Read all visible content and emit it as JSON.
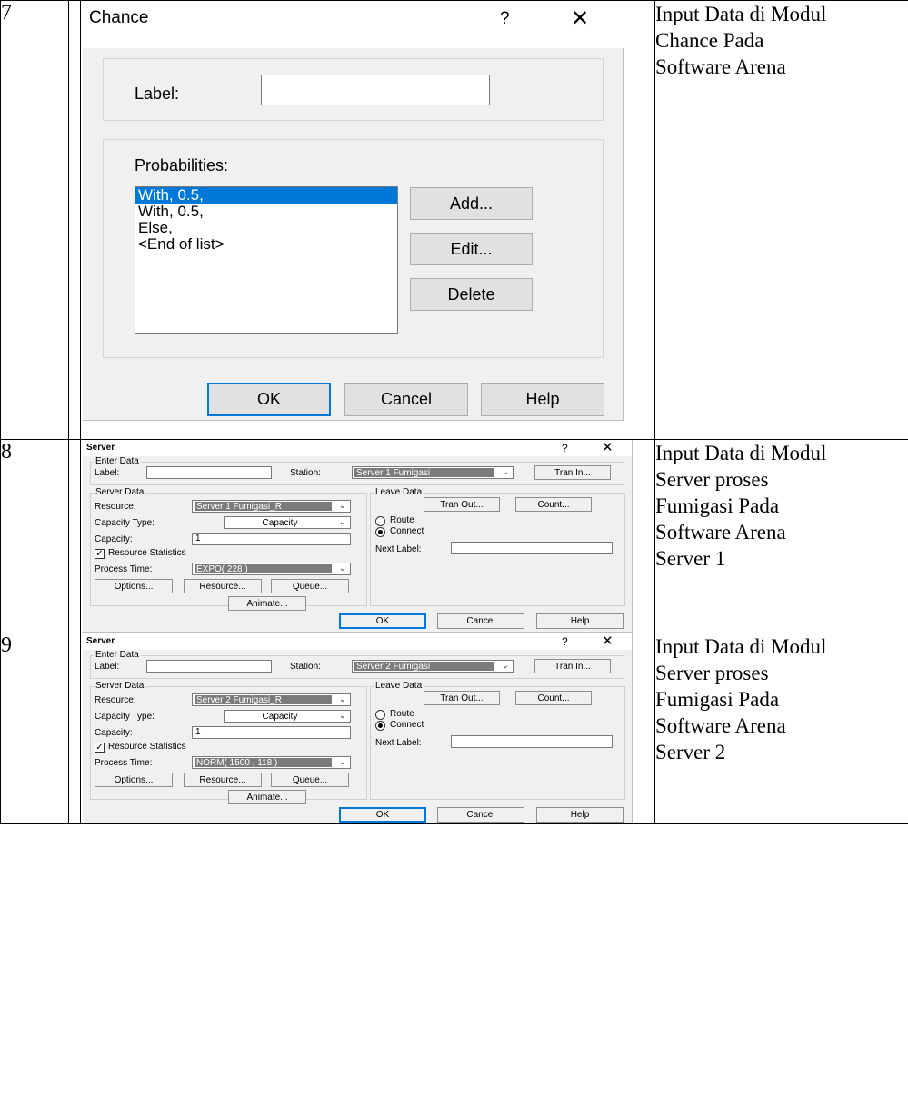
{
  "rows": [
    {
      "number": "7",
      "description": [
        "Input Data di Modul",
        "Chance Pada",
        "Software Arena"
      ]
    },
    {
      "number": "8",
      "description": [
        "Input Data di Modul",
        "Server proses",
        "Fumigasi Pada",
        "Software Arena",
        "Server 1"
      ]
    },
    {
      "number": "9",
      "description": [
        "Input Data di Modul",
        "Server proses",
        "Fumigasi Pada",
        "Software Arena",
        "Server 2"
      ]
    }
  ],
  "chance_dialog": {
    "title": "Chance",
    "help_glyph": "?",
    "close_glyph": "✕",
    "label_caption": "Label:",
    "label_value": "",
    "probabilities_caption": "Probabilities:",
    "probabilities": [
      "With, 0.5,",
      "With, 0.5,",
      "Else,",
      "<End of list>"
    ],
    "selected_index": 0,
    "add_label": "Add...",
    "edit_label": "Edit...",
    "delete_label": "Delete",
    "ok_label": "OK",
    "cancel_label": "Cancel",
    "help_label": "Help"
  },
  "server_dialogs": [
    {
      "title": "Server",
      "help_glyph": "?",
      "close_glyph": "✕",
      "enter_data_title": "Enter Data",
      "label_caption": "Label:",
      "label_value": "",
      "station_caption": "Station:",
      "station_value": "Server 1 Fumigasi",
      "tran_in_label": "Tran In...",
      "server_data_title": "Server Data",
      "resource_caption": "Resource:",
      "resource_value": "Server 1 Fumigasi_R",
      "capacity_type_caption": "Capacity Type:",
      "capacity_type_value": "Capacity",
      "capacity_caption": "Capacity:",
      "capacity_value": "1",
      "resource_statistics_label": "Resource Statistics",
      "resource_statistics_checked": true,
      "process_time_caption": "Process Time:",
      "process_time_value": "EXPO( 228 )",
      "options_label": "Options...",
      "resource_button_label": "Resource...",
      "queue_label": "Queue...",
      "animate_label": "Animate...",
      "leave_data_title": "Leave Data",
      "tran_out_label": "Tran Out...",
      "count_label": "Count...",
      "route_label": "Route",
      "connect_label": "Connect",
      "selected_leave_option": "Connect",
      "next_label_caption": "Next Label:",
      "next_label_value": "",
      "ok_label": "OK",
      "cancel_label": "Cancel",
      "help_label": "Help"
    },
    {
      "title": "Server",
      "help_glyph": "?",
      "close_glyph": "✕",
      "enter_data_title": "Enter Data",
      "label_caption": "Label:",
      "label_value": "",
      "station_caption": "Station:",
      "station_value": "Server 2 Fumigasi",
      "tran_in_label": "Tran In...",
      "server_data_title": "Server Data",
      "resource_caption": "Resource:",
      "resource_value": "Server 2 Fumigasi_R",
      "capacity_type_caption": "Capacity Type:",
      "capacity_type_value": "Capacity",
      "capacity_caption": "Capacity:",
      "capacity_value": "1",
      "resource_statistics_label": "Resource Statistics",
      "resource_statistics_checked": true,
      "process_time_caption": "Process Time:",
      "process_time_value": "NORM( 1500 , 118 )",
      "options_label": "Options...",
      "resource_button_label": "Resource...",
      "queue_label": "Queue...",
      "animate_label": "Animate...",
      "leave_data_title": "Leave Data",
      "tran_out_label": "Tran Out...",
      "count_label": "Count...",
      "route_label": "Route",
      "connect_label": "Connect",
      "selected_leave_option": "Connect",
      "next_label_caption": "Next Label:",
      "next_label_value": "",
      "ok_label": "OK",
      "cancel_label": "Cancel",
      "help_label": "Help"
    }
  ],
  "colors": {
    "dialog_bg": "#f0f0f0",
    "selection": "#0078d7",
    "default_button_border": "#0078d7",
    "disabled_field": "#7b7b7b"
  }
}
